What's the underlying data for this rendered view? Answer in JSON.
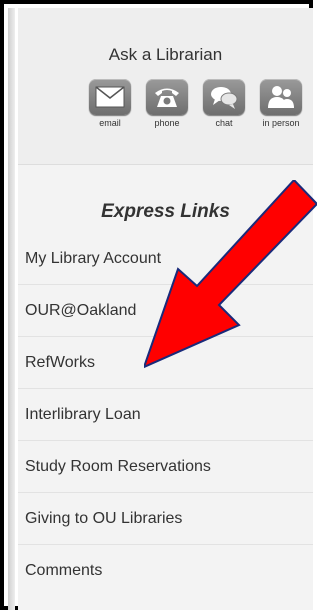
{
  "ask": {
    "title": "Ask a Librarian",
    "items": [
      {
        "label": "email",
        "icon": "envelope-icon"
      },
      {
        "label": "phone",
        "icon": "telephone-icon"
      },
      {
        "label": "chat",
        "icon": "chat-bubble-icon"
      },
      {
        "label": "in person",
        "icon": "people-icon"
      }
    ]
  },
  "express": {
    "title": "Express Links",
    "links": [
      {
        "label": "My Library Account"
      },
      {
        "label": "OUR@Oakland"
      },
      {
        "label": "RefWorks"
      },
      {
        "label": "Interlibrary Loan"
      },
      {
        "label": "Study Room Reservations"
      },
      {
        "label": "Giving to OU Libraries"
      },
      {
        "label": "Comments"
      }
    ]
  },
  "annotation": {
    "arrow_color": "#ff0000",
    "points_to": "RefWorks"
  }
}
